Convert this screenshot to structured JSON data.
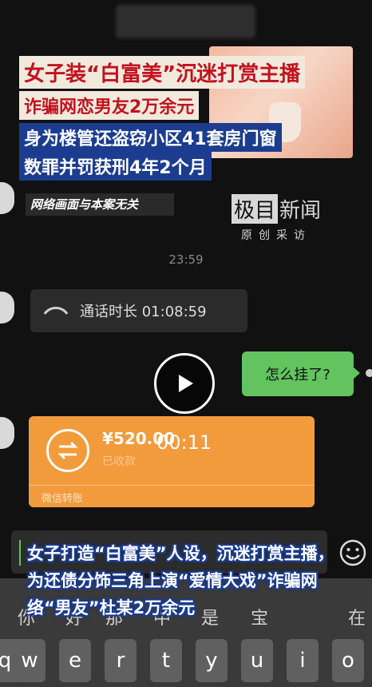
{
  "headlines": {
    "line1": "女子装“白富美”沉迷打赏主播",
    "line2": "诈骗网恋男友2万余元",
    "line3": "身为楼管还盗窃小区41套房门窗",
    "line4": "数罪并罚获刑4年2个月"
  },
  "disclaimer": "网络画面与本案无关",
  "logo": {
    "brand_box": "极目",
    "brand_rest": "新闻",
    "slogan": "原创采访"
  },
  "chat": {
    "timestamp": "23:59",
    "call_label": "通话时长 01:08:59",
    "my_message": "怎么挂了?",
    "transfer_amount": "¥520.00",
    "transfer_sub": "已收款",
    "transfer_label": "微信转账"
  },
  "video": {
    "current_time": "00:11"
  },
  "caption": "女子打造“白富美”人设，沉迷打赏主播，为还债分饰三角上演“爱情大戏”诈骗网络“男友”杜某2万余元",
  "keyboard": {
    "candidates": [
      "你",
      "好",
      "那",
      "中",
      "是",
      "宝",
      "在"
    ],
    "keys": [
      "q",
      "w",
      "e",
      "r",
      "t",
      "y",
      "u",
      "i",
      "o"
    ]
  },
  "colors": {
    "headline_red": "#c1121f",
    "headline_blue": "#1c3d8f",
    "wechat_green": "#62c35f",
    "transfer_orange": "#f29b3c"
  }
}
